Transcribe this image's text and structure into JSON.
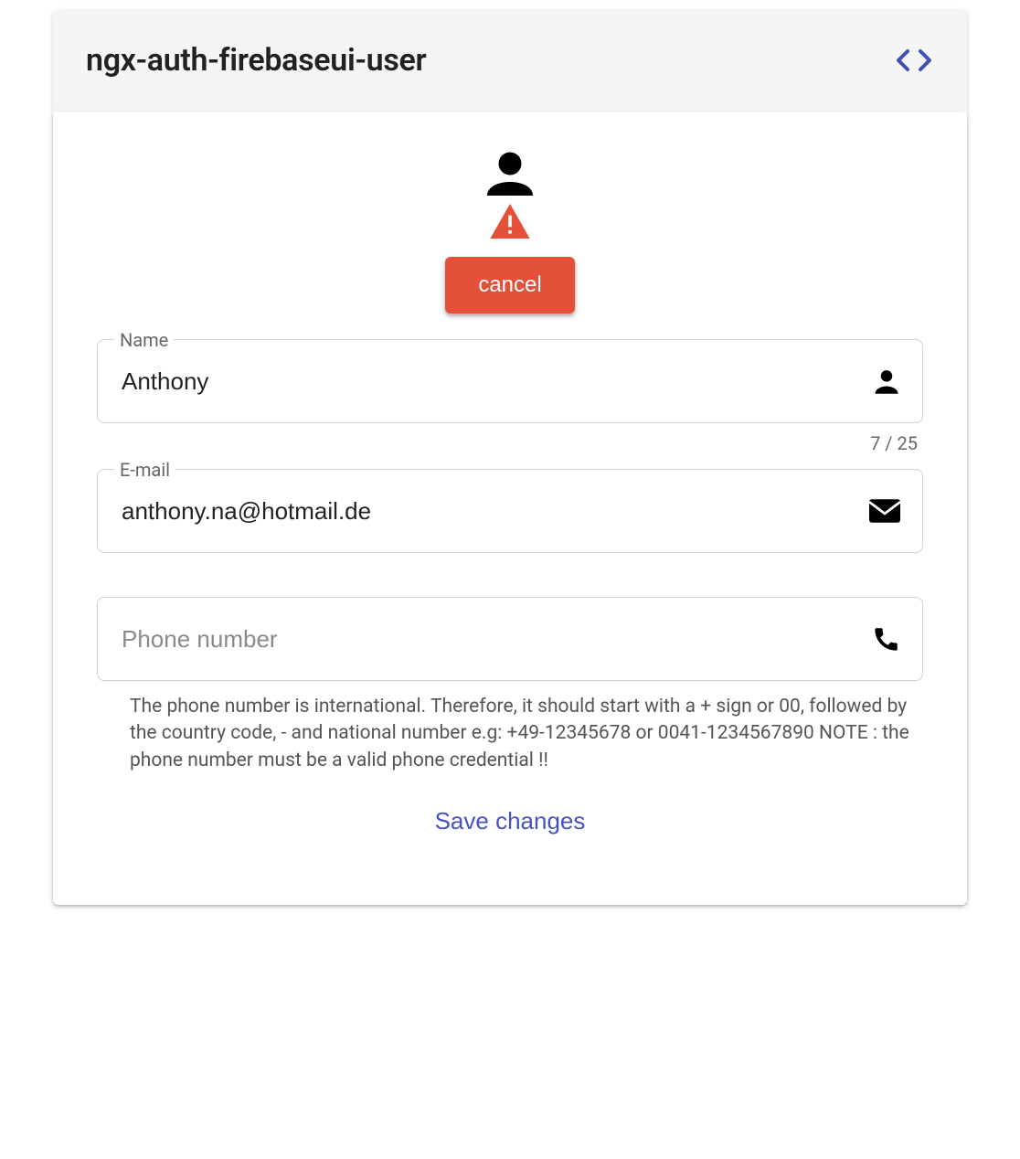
{
  "header": {
    "title": "ngx-auth-firebaseui-user"
  },
  "actions": {
    "cancel_label": "cancel",
    "save_label": "Save changes"
  },
  "fields": {
    "name": {
      "label": "Name",
      "value": "Anthony",
      "max_length": 25,
      "counter": "7 / 25"
    },
    "email": {
      "label": "E-mail",
      "value": "anthony.na@hotmail.de"
    },
    "phone": {
      "label": "Phone number",
      "placeholder": "Phone number",
      "value": "",
      "hint": "The phone number is international. Therefore, it should start with a + sign or 00, followed by the country code, - and national number e.g: +49-12345678 or 0041-1234567890 NOTE : the phone number must be a valid phone credential !!"
    }
  },
  "icons": {
    "code": "code-icon",
    "avatar": "person-icon",
    "warning": "warning-icon",
    "person": "person-icon",
    "email": "email-icon",
    "phone": "phone-icon"
  },
  "colors": {
    "warn": "#e55039",
    "primary": "#3f51b5"
  }
}
